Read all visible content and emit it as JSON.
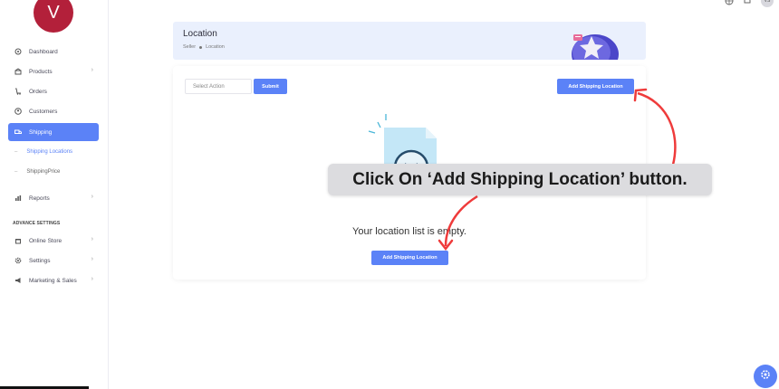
{
  "brand": {
    "logo_letter": "V",
    "color": "#b3203a"
  },
  "accent": "#5b82f7",
  "sidebar": {
    "items": [
      {
        "label": "Dashboard",
        "icon": "grid-icon"
      },
      {
        "label": "Products",
        "icon": "box-icon"
      },
      {
        "label": "Orders",
        "icon": "cart-icon"
      },
      {
        "label": "Customers",
        "icon": "user-icon"
      },
      {
        "label": "Shipping",
        "icon": "truck-icon"
      }
    ],
    "sub_items": [
      {
        "label": "Shipping Locations"
      },
      {
        "label": "ShippingPrice"
      }
    ],
    "reports": {
      "label": "Reports",
      "icon": "chart-icon"
    },
    "section_label": "ADVANCE SETTINGS",
    "advance_items": [
      {
        "label": "Online Store",
        "icon": "store-icon"
      },
      {
        "label": "Settings",
        "icon": "gear-icon"
      },
      {
        "label": "Marketing & Sales",
        "icon": "megaphone-icon"
      }
    ]
  },
  "topbar": {
    "user_initials": "VS"
  },
  "header": {
    "title": "Location",
    "breadcrumb": [
      "Seller",
      "Location"
    ]
  },
  "toolbar": {
    "select_placeholder": "Select Action",
    "submit_label": "Submit",
    "add_label": "Add Shipping Location"
  },
  "empty_state": {
    "message": "Your location list is empty.",
    "button_label": "Add Shipping Location"
  },
  "annotation": {
    "text": "Click On ‘Add Shipping Location’ button.",
    "arrow_color": "#ef3b3b"
  }
}
